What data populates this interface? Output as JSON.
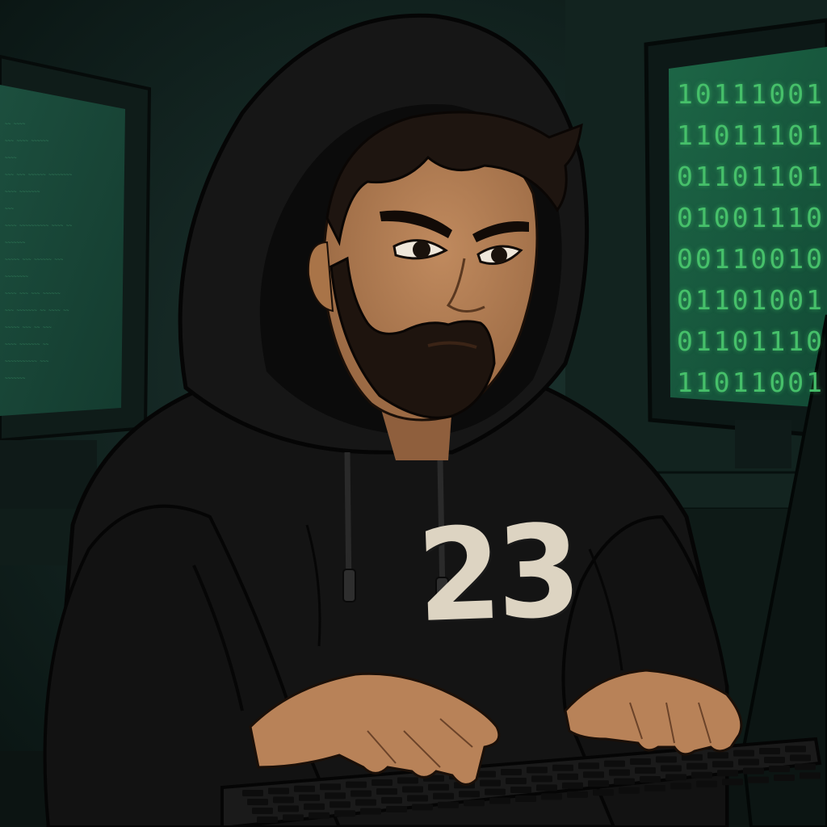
{
  "scene": {
    "right_monitor": {
      "binary_rows": [
        "10111001",
        "11011101",
        "01101101",
        "01001110",
        "00110010",
        "01101001",
        "01101110",
        "11011001"
      ]
    },
    "left_monitor": {
      "code_lines": [
        "~~ ~~~~",
        "~~~ ~~~~ ~~~~~~",
        "~~~~",
        "~~~ ~~~ ~~~~~~ ~~~~~~~~",
        "~~~~ ~~~~~~~",
        "~~~",
        "~~~~ ~~~~~~~~~~ ~~~~ ~~",
        "~~~~~~~",
        "~~~~~ ~~~ ~~~~~~ ~~~",
        "~~~~~~~~",
        "~~~~ ~~~ ~~~ ~~~~~~",
        "~~~ ~~~~~~~ ~~ ~~~~ ~~",
        "~~~~~ ~~~ ~~ ~~~",
        "~~~~ ~~~~~~~ ~~",
        "~~~~~~~~~~~ ~~~",
        "~~~~~~~"
      ]
    },
    "hoodie": {
      "jersey_number": "23"
    },
    "colors": {
      "background": "#0e1a18",
      "screen_glow": "#1f6b4a",
      "binary_text": "#46c06a",
      "hoodie": "#131313",
      "skin": "#b88258"
    }
  }
}
